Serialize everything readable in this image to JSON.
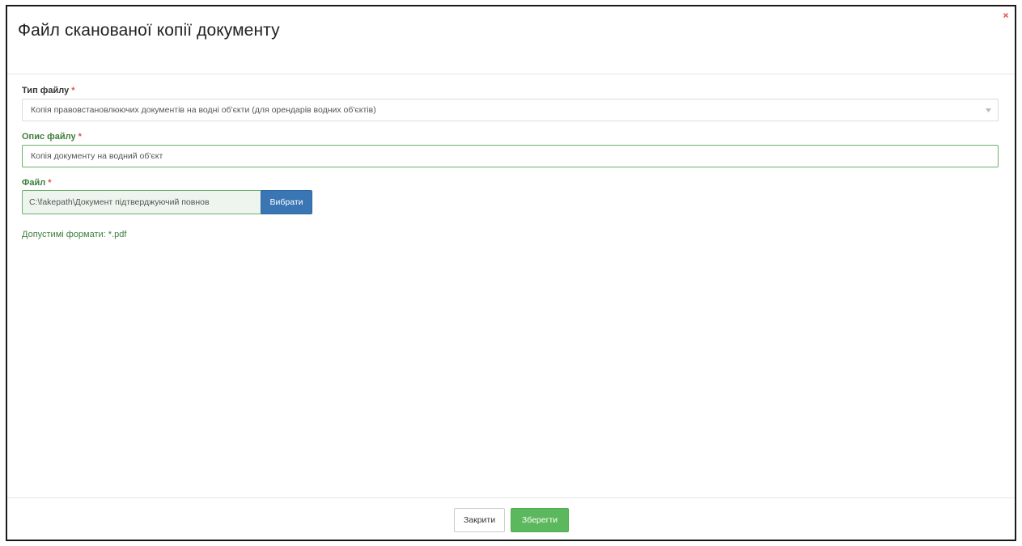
{
  "dialog": {
    "title": "Файл сканованої копії документу",
    "close_icon": "close-icon",
    "close_icon_color": "#d9534f"
  },
  "form": {
    "file_type": {
      "label": "Тип файлу",
      "required_mark": "*",
      "selected_value": "Копія правовстановлюючих документів на водні об'єкти (для орендарів водних об'єктів)"
    },
    "file_description": {
      "label": "Опис файлу",
      "required_mark": "*",
      "value": "Копія документу на водний об'єкт"
    },
    "file": {
      "label": "Файл",
      "required_mark": "*",
      "path_value": "C:\\fakepath\\Документ підтверджуючий повнов",
      "browse_label": "Вибрати"
    },
    "formats_hint": "Допустимі формати: *.pdf"
  },
  "footer": {
    "close_label": "Закрити",
    "save_label": "Зберегти"
  },
  "colors": {
    "primary": "#3a75b4",
    "success": "#5cb85c",
    "valid_label": "#3d7d3d",
    "required": "#d9534f"
  }
}
